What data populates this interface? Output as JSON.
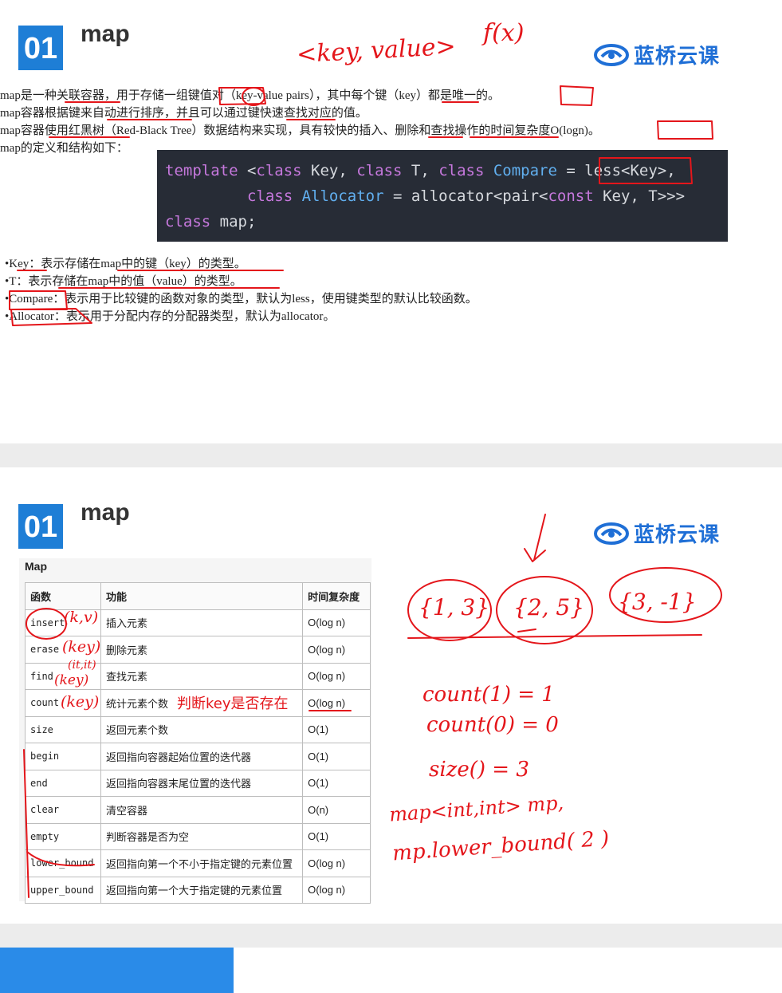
{
  "slide1": {
    "number": "01",
    "title": "map",
    "logo_text": "蓝桥云课",
    "paragraphs": [
      "map是一种关联容器，用于存储一组键值对（key-value pairs），其中每个键（key）都是唯一的。",
      "map容器根据键来自动进行排序，并且可以通过键快速查找对应的值。",
      "map容器使用红黑树（Red-Black Tree）数据结构来实现，具有较快的插入、删除和查找操作的时间复杂度O(logn)。",
      "map的定义和结构如下："
    ],
    "code": {
      "line1": {
        "kw1": "template",
        "p1": " <",
        "kw2": "class",
        "p2": " Key, ",
        "kw3": "class",
        "p3": " T, ",
        "kw4": "class",
        "ty1": " Compare",
        "p4": " = less<Key>,"
      },
      "line2": {
        "p1": "         ",
        "kw1": "class",
        "ty1": " Allocator",
        "p2": " = allocator<pair<",
        "kw2": "const",
        "p3": " Key, T>>>"
      },
      "line3": {
        "kw1": "class",
        "p1": " map;"
      }
    },
    "bullets": [
      "•Key：表示存储在map中的键（key）的类型。",
      "•T：表示存储在map中的值（value）的类型。",
      "•Compare：表示用于比较键的函数对象的类型，默认为less，使用键类型的默认比较函数。",
      "•Allocator：表示用于分配内存的分配器类型，默认为allocator。"
    ],
    "handwriting": {
      "key_value": "<key, value>",
      "fx": "f(x)"
    }
  },
  "slide2": {
    "number": "01",
    "title": "map",
    "logo_text": "蓝桥云课",
    "table_caption": "Map",
    "table_headers": [
      "函数",
      "功能",
      "时间复杂度"
    ],
    "table_rows": [
      [
        "insert",
        "插入元素",
        "O(log n)"
      ],
      [
        "erase",
        "删除元素",
        "O(log n)"
      ],
      [
        "find",
        "查找元素",
        "O(log n)"
      ],
      [
        "count",
        "统计元素个数",
        "O(log n)"
      ],
      [
        "size",
        "返回元素个数",
        "O(1)"
      ],
      [
        "begin",
        "返回指向容器起始位置的迭代器",
        "O(1)"
      ],
      [
        "end",
        "返回指向容器末尾位置的迭代器",
        "O(1)"
      ],
      [
        "clear",
        "清空容器",
        "O(n)"
      ],
      [
        "empty",
        "判断容器是否为空",
        "O(1)"
      ],
      [
        "lower_bound",
        "返回指向第一个不小于指定键的元素位置",
        "O(log n)"
      ],
      [
        "upper_bound",
        "返回指向第一个大于指定键的元素位置",
        "O(log n)"
      ]
    ],
    "handwriting": {
      "insert_note": "(k,v)",
      "erase_note": "(key)",
      "erase_note2": "(it,it)",
      "find_note": "(key)",
      "count_note": "(key)",
      "count_remark": "判断key是否存在",
      "pair1": "{1, 3}",
      "pair2": "{2, 5}",
      "pair3": "{3, -1}",
      "line1": "count(1) = 1",
      "line2": "count(0) = 0",
      "line3": "size() = 3",
      "line4": "map<int,int> mp,",
      "line5": "mp.lower_bound( 2 )"
    }
  },
  "colors": {
    "accent": "#1e7ed6",
    "ink": "#e4161b",
    "code_bg": "#272c36",
    "bottom_bar": "#2a8be8"
  }
}
